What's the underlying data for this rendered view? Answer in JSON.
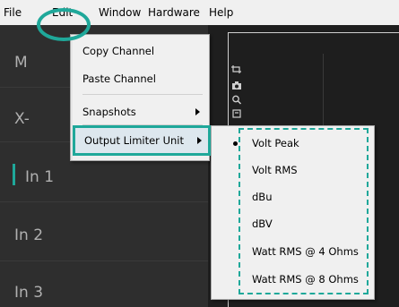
{
  "menubar": {
    "file": "File",
    "edit": "Edit",
    "window": "Window",
    "hardware": "Hardware",
    "help": "Help"
  },
  "left_panel": {
    "rows": [
      "M",
      "X-",
      "In 1",
      "In 2",
      "In 3"
    ]
  },
  "edit_menu": {
    "items": [
      "Copy Channel",
      "Paste Channel",
      "Snapshots",
      "Output Limiter Unit"
    ],
    "highlighted": "Output Limiter Unit"
  },
  "output_limiter_menu": {
    "items": [
      "Volt Peak",
      "Volt RMS",
      "dBu",
      "dBV",
      "Watt RMS @ 4 Ohms",
      "Watt RMS @ 8 Ohms"
    ],
    "selected": "Volt Peak"
  },
  "toolbar_icons": [
    "crop-icon",
    "camera-icon",
    "zoom-icon",
    "select-icon"
  ],
  "colors": {
    "highlight": "#1fa89a",
    "menu_bg": "#f0f0f0",
    "app_bg": "#2c2c2c"
  }
}
